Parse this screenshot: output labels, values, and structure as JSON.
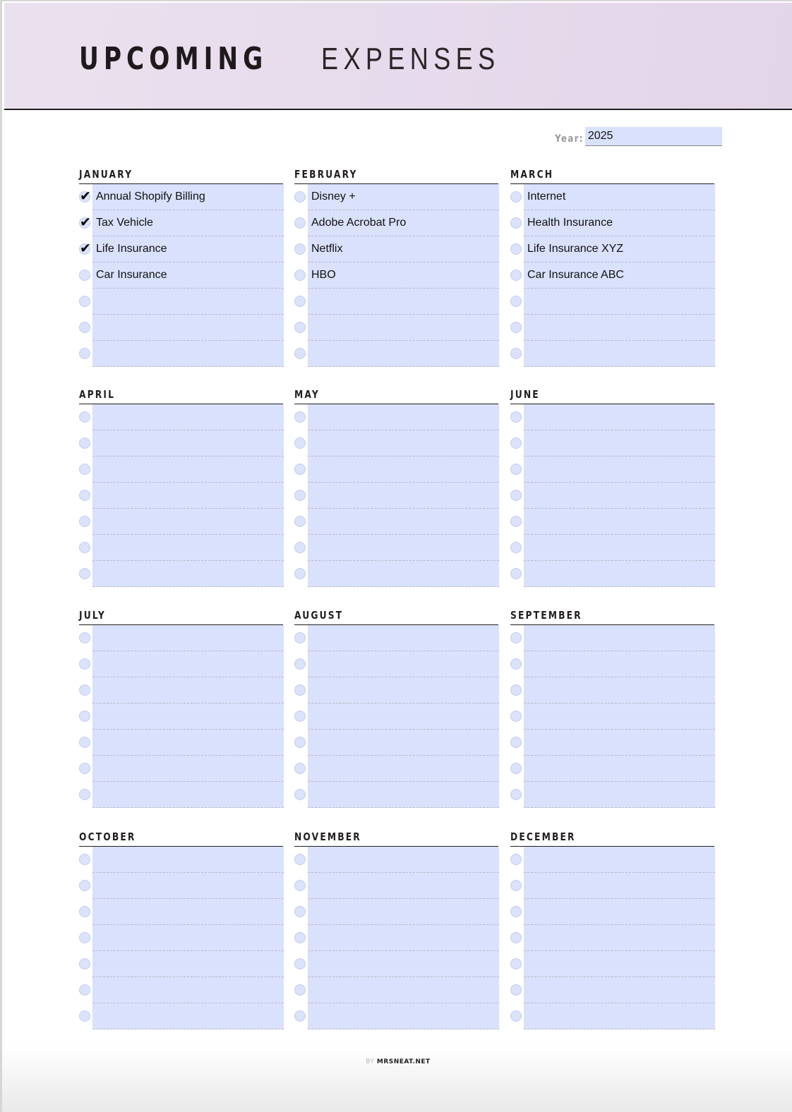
{
  "header": {
    "title_bold": "UPCOMING",
    "title_light": "EXPENSES"
  },
  "year": {
    "label": "Year:",
    "value": "2025"
  },
  "months": [
    {
      "name": "JANUARY",
      "items": [
        {
          "text": "Annual Shopify Billing",
          "checked": true
        },
        {
          "text": "Tax Vehicle",
          "checked": true
        },
        {
          "text": "Life Insurance",
          "checked": true
        },
        {
          "text": "Car Insurance",
          "checked": false
        },
        {
          "text": "",
          "checked": false
        },
        {
          "text": "",
          "checked": false
        },
        {
          "text": "",
          "checked": false
        }
      ]
    },
    {
      "name": "FEBRUARY",
      "items": [
        {
          "text": "Disney +",
          "checked": false
        },
        {
          "text": "Adobe Acrobat Pro",
          "checked": false
        },
        {
          "text": "Netflix",
          "checked": false
        },
        {
          "text": "HBO",
          "checked": false
        },
        {
          "text": "",
          "checked": false
        },
        {
          "text": "",
          "checked": false
        },
        {
          "text": "",
          "checked": false
        }
      ]
    },
    {
      "name": "MARCH",
      "items": [
        {
          "text": "Internet",
          "checked": false
        },
        {
          "text": "Health Insurance",
          "checked": false
        },
        {
          "text": "Life Insurance XYZ",
          "checked": false
        },
        {
          "text": "Car Insurance ABC",
          "checked": false
        },
        {
          "text": "",
          "checked": false
        },
        {
          "text": "",
          "checked": false
        },
        {
          "text": "",
          "checked": false
        }
      ]
    },
    {
      "name": "APRIL",
      "items": [
        {
          "text": "",
          "checked": false
        },
        {
          "text": "",
          "checked": false
        },
        {
          "text": "",
          "checked": false
        },
        {
          "text": "",
          "checked": false
        },
        {
          "text": "",
          "checked": false
        },
        {
          "text": "",
          "checked": false
        },
        {
          "text": "",
          "checked": false
        }
      ]
    },
    {
      "name": "MAY",
      "items": [
        {
          "text": "",
          "checked": false
        },
        {
          "text": "",
          "checked": false
        },
        {
          "text": "",
          "checked": false
        },
        {
          "text": "",
          "checked": false
        },
        {
          "text": "",
          "checked": false
        },
        {
          "text": "",
          "checked": false
        },
        {
          "text": "",
          "checked": false
        }
      ]
    },
    {
      "name": "JUNE",
      "items": [
        {
          "text": "",
          "checked": false
        },
        {
          "text": "",
          "checked": false
        },
        {
          "text": "",
          "checked": false
        },
        {
          "text": "",
          "checked": false
        },
        {
          "text": "",
          "checked": false
        },
        {
          "text": "",
          "checked": false
        },
        {
          "text": "",
          "checked": false
        }
      ]
    },
    {
      "name": "JULY",
      "items": [
        {
          "text": "",
          "checked": false
        },
        {
          "text": "",
          "checked": false
        },
        {
          "text": "",
          "checked": false
        },
        {
          "text": "",
          "checked": false
        },
        {
          "text": "",
          "checked": false
        },
        {
          "text": "",
          "checked": false
        },
        {
          "text": "",
          "checked": false
        }
      ]
    },
    {
      "name": "AUGUST",
      "items": [
        {
          "text": "",
          "checked": false
        },
        {
          "text": "",
          "checked": false
        },
        {
          "text": "",
          "checked": false
        },
        {
          "text": "",
          "checked": false
        },
        {
          "text": "",
          "checked": false
        },
        {
          "text": "",
          "checked": false
        },
        {
          "text": "",
          "checked": false
        }
      ]
    },
    {
      "name": "SEPTEMBER",
      "items": [
        {
          "text": "",
          "checked": false
        },
        {
          "text": "",
          "checked": false
        },
        {
          "text": "",
          "checked": false
        },
        {
          "text": "",
          "checked": false
        },
        {
          "text": "",
          "checked": false
        },
        {
          "text": "",
          "checked": false
        },
        {
          "text": "",
          "checked": false
        }
      ]
    },
    {
      "name": "OCTOBER",
      "items": [
        {
          "text": "",
          "checked": false
        },
        {
          "text": "",
          "checked": false
        },
        {
          "text": "",
          "checked": false
        },
        {
          "text": "",
          "checked": false
        },
        {
          "text": "",
          "checked": false
        },
        {
          "text": "",
          "checked": false
        },
        {
          "text": "",
          "checked": false
        }
      ]
    },
    {
      "name": "NOVEMBER",
      "items": [
        {
          "text": "",
          "checked": false
        },
        {
          "text": "",
          "checked": false
        },
        {
          "text": "",
          "checked": false
        },
        {
          "text": "",
          "checked": false
        },
        {
          "text": "",
          "checked": false
        },
        {
          "text": "",
          "checked": false
        },
        {
          "text": "",
          "checked": false
        }
      ]
    },
    {
      "name": "DECEMBER",
      "items": [
        {
          "text": "",
          "checked": false
        },
        {
          "text": "",
          "checked": false
        },
        {
          "text": "",
          "checked": false
        },
        {
          "text": "",
          "checked": false
        },
        {
          "text": "",
          "checked": false
        },
        {
          "text": "",
          "checked": false
        },
        {
          "text": "",
          "checked": false
        }
      ]
    }
  ],
  "checkmark_glyph": "✔",
  "footer": {
    "by": "BY",
    "site": "MRSNEAT.NET"
  }
}
